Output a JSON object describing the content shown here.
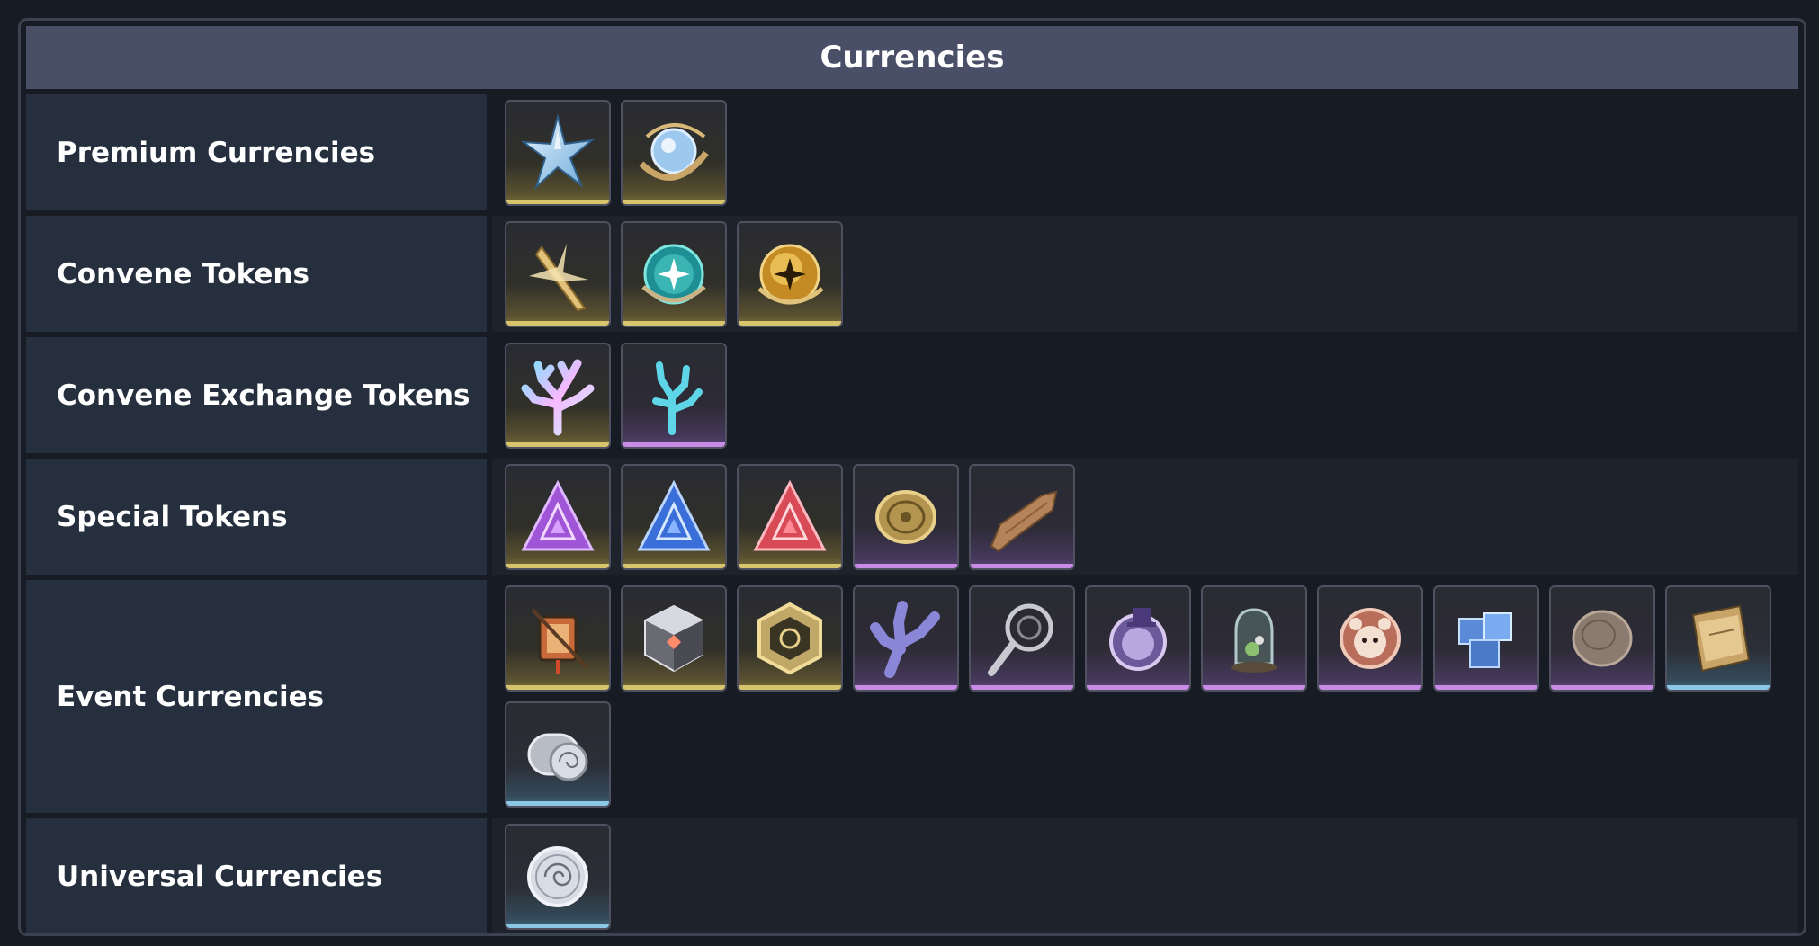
{
  "header": {
    "title": "Currencies"
  },
  "rows": [
    {
      "label": "Premium Currencies",
      "items": [
        {
          "icon": "star-crystal-icon",
          "rarity": "gold"
        },
        {
          "icon": "orb-ring-icon",
          "rarity": "gold"
        }
      ]
    },
    {
      "label": "Convene Tokens",
      "items": [
        {
          "icon": "golden-blade-icon",
          "rarity": "gold"
        },
        {
          "icon": "teal-orb-icon",
          "rarity": "gold"
        },
        {
          "icon": "gold-orb-icon",
          "rarity": "gold"
        }
      ]
    },
    {
      "label": "Convene Exchange Tokens",
      "items": [
        {
          "icon": "iridescent-coral-icon",
          "rarity": "gold"
        },
        {
          "icon": "blue-coral-icon",
          "rarity": "purple"
        }
      ]
    },
    {
      "label": "Special Tokens",
      "items": [
        {
          "icon": "purple-triangle-icon",
          "rarity": "gold"
        },
        {
          "icon": "blue-triangle-icon",
          "rarity": "gold"
        },
        {
          "icon": "red-triangle-icon",
          "rarity": "gold"
        },
        {
          "icon": "gold-coin-icon",
          "rarity": "purple"
        },
        {
          "icon": "wood-plank-icon",
          "rarity": "purple"
        }
      ]
    },
    {
      "label": "Event Currencies",
      "items": [
        {
          "icon": "lantern-icon",
          "rarity": "gold"
        },
        {
          "icon": "cube-icon",
          "rarity": "gold"
        },
        {
          "icon": "hexagon-emblem-icon",
          "rarity": "gold"
        },
        {
          "icon": "purple-coral-icon",
          "rarity": "purple"
        },
        {
          "icon": "magnifier-icon",
          "rarity": "purple"
        },
        {
          "icon": "cat-badge-icon",
          "rarity": "purple"
        },
        {
          "icon": "glass-dome-icon",
          "rarity": "purple"
        },
        {
          "icon": "bear-coin-icon",
          "rarity": "purple"
        },
        {
          "icon": "ice-cubes-icon",
          "rarity": "purple"
        },
        {
          "icon": "stone-coin-icon",
          "rarity": "purple"
        },
        {
          "icon": "ticket-book-icon",
          "rarity": "blue"
        },
        {
          "icon": "shell-roll-icon",
          "rarity": "blue"
        }
      ]
    },
    {
      "label": "Universal Currencies",
      "items": [
        {
          "icon": "shell-coin-icon",
          "rarity": "blue"
        }
      ]
    }
  ]
}
